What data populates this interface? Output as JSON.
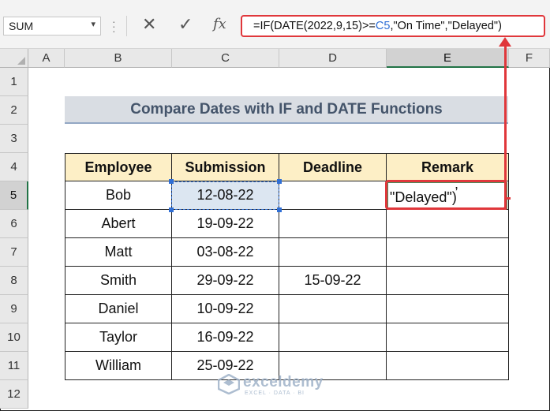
{
  "formula_bar": {
    "name_box": "SUM",
    "name_box_dropdown": "▾",
    "cancel_glyph": "✕",
    "enter_glyph": "✓",
    "fx_label": "fx",
    "formula_prefix": "=IF(DATE(2022,9,15)>=",
    "formula_ref": "C5",
    "formula_suffix": ",\"On Time\",\"Delayed\")"
  },
  "columns": [
    "A",
    "B",
    "C",
    "D",
    "E",
    "F"
  ],
  "rows": [
    "1",
    "2",
    "3",
    "4",
    "5",
    "6",
    "7",
    "8",
    "9",
    "10",
    "11",
    "12"
  ],
  "title": "Compare Dates with IF and DATE Functions",
  "table": {
    "headers": [
      "Employee",
      "Submission",
      "Deadline",
      "Remark"
    ],
    "rows": [
      {
        "employee": "Bob",
        "submission": "12-08-22",
        "deadline": ""
      },
      {
        "employee": "Abert",
        "submission": "19-09-22",
        "deadline": ""
      },
      {
        "employee": "Matt",
        "submission": "03-08-22",
        "deadline": ""
      },
      {
        "employee": "Smith",
        "submission": "29-09-22",
        "deadline": "15-09-22"
      },
      {
        "employee": "Daniel",
        "submission": "10-09-22",
        "deadline": ""
      },
      {
        "employee": "Taylor",
        "submission": "16-09-22",
        "deadline": ""
      },
      {
        "employee": "William",
        "submission": "25-09-22",
        "deadline": ""
      }
    ]
  },
  "edit_cell": {
    "text": "\"Delayed\")",
    "partial_above": ","
  },
  "watermark": {
    "name": "exceldemy",
    "tagline": "EXCEL · DATA · BI"
  },
  "colors": {
    "highlight": "#e0373b",
    "header_fill": "#fdefc6",
    "title_fill": "#d9dde3",
    "reference_blue": "#2f6fd6",
    "excel_green": "#217346"
  }
}
